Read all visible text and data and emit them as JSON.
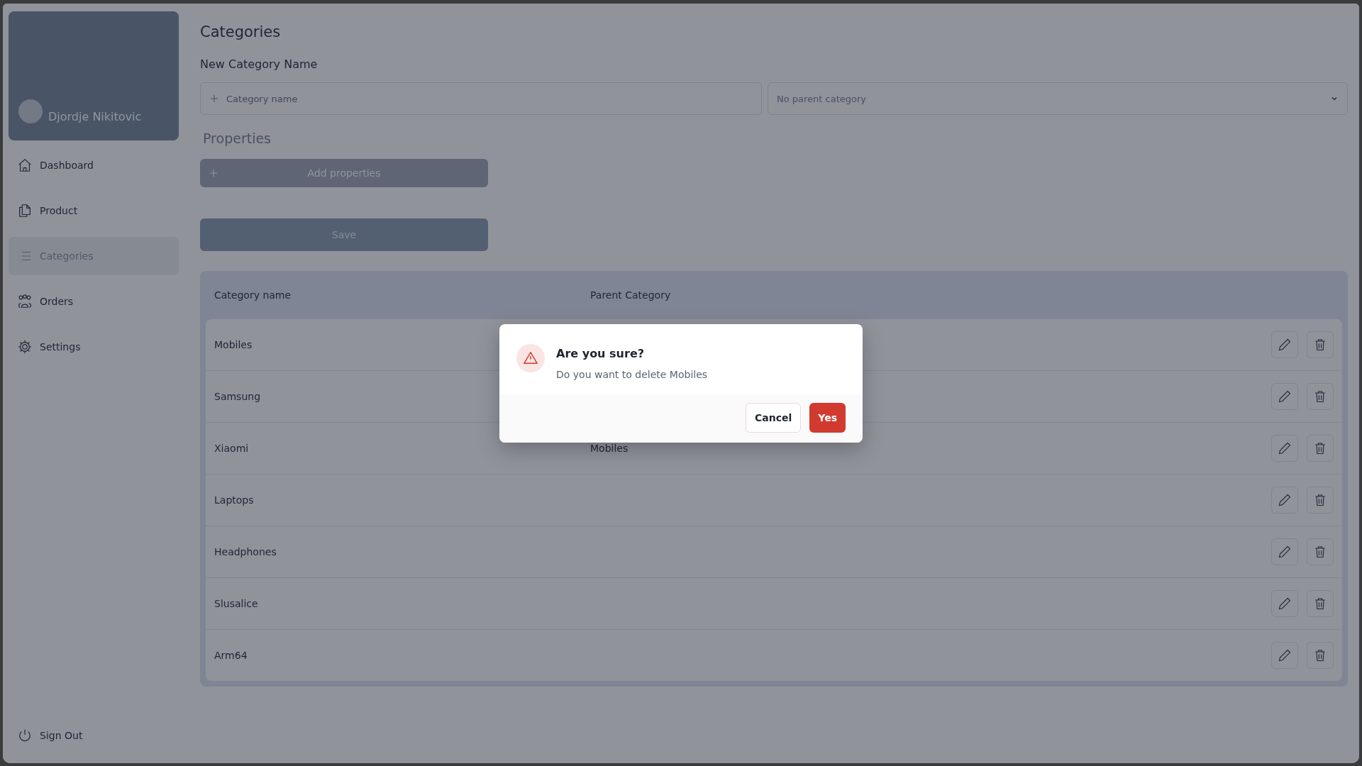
{
  "sidebar": {
    "user_name": "Djordje Nikitovic",
    "items": [
      {
        "label": "Dashboard",
        "selected": false
      },
      {
        "label": "Product",
        "selected": false
      },
      {
        "label": "Categories",
        "selected": true
      },
      {
        "label": "Orders",
        "selected": false
      },
      {
        "label": "Settings",
        "selected": false
      }
    ],
    "sign_out": "Sign Out"
  },
  "page_title": "Categories",
  "form": {
    "label": "New Category Name",
    "name_placeholder": "Category name",
    "parent_select": "No parent category",
    "properties_label": "Properties",
    "add_properties": "Add properties",
    "save": "Save"
  },
  "table": {
    "columns": [
      "Category name",
      "Parent Category"
    ],
    "rows": [
      {
        "name": "Mobiles"
      },
      {
        "name": "Samsung"
      },
      {
        "name": "Xiaomi",
        "parent": "Mobiles"
      },
      {
        "name": "Laptops"
      },
      {
        "name": "Headphones"
      },
      {
        "name": "Slusalice"
      },
      {
        "name": "Arm64"
      }
    ]
  },
  "dialog": {
    "title": "Are you sure?",
    "message": "Do you want to delete Mobiles",
    "buttons": [
      {
        "label": "Cancel",
        "kind": "secondary"
      },
      {
        "label": "Yes",
        "kind": "danger"
      }
    ]
  }
}
